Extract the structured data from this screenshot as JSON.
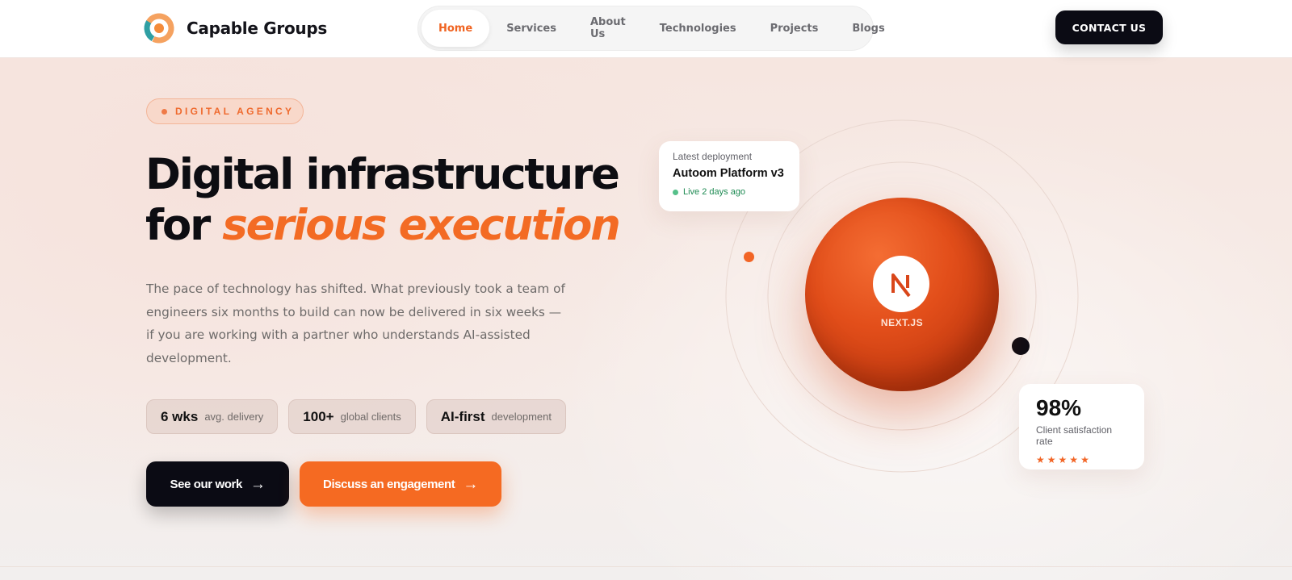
{
  "brand": {
    "name": "Capable Groups"
  },
  "nav": {
    "items": [
      {
        "label": "Home",
        "active": true
      },
      {
        "label": "Services",
        "active": false
      },
      {
        "label": "About Us",
        "active": false
      },
      {
        "label": "Technologies",
        "active": false
      },
      {
        "label": "Projects",
        "active": false
      },
      {
        "label": "Blogs",
        "active": false
      }
    ]
  },
  "header": {
    "contact_label": "CONTACT US"
  },
  "hero": {
    "badge": "DIGITAL AGENCY",
    "headline_line1": "Digital infrastructure",
    "headline_line2_prefix": "for",
    "headline_accent": "serious execution",
    "lead": "The pace of technology has shifted. What previously took a team of engineers six months to build can now be delivered in six weeks — if you are working with a partner who understands AI-assisted development.",
    "stats": [
      {
        "value": "6 wks",
        "label": "avg. delivery"
      },
      {
        "value": "100+",
        "label": "global clients"
      },
      {
        "value": "AI-first",
        "label": "development"
      }
    ],
    "cta_primary": "See our work",
    "cta_secondary": "Discuss an engagement",
    "arrow": "→"
  },
  "visual": {
    "tech_label": "NEXT.JS",
    "deploy": {
      "kicker": "Latest deployment",
      "title": "Autoom Platform v3",
      "status": "Live 2 days ago"
    },
    "satisfaction": {
      "value": "98%",
      "label": "Client satisfaction rate",
      "rating": 5
    }
  },
  "colors": {
    "accent": "#f56a22",
    "dark": "#0b0b14",
    "live_green": "#1d8a52"
  },
  "icons": [
    "capable-groups-logo",
    "nextjs-icon",
    "arrow-right-icon",
    "star-icon"
  ]
}
